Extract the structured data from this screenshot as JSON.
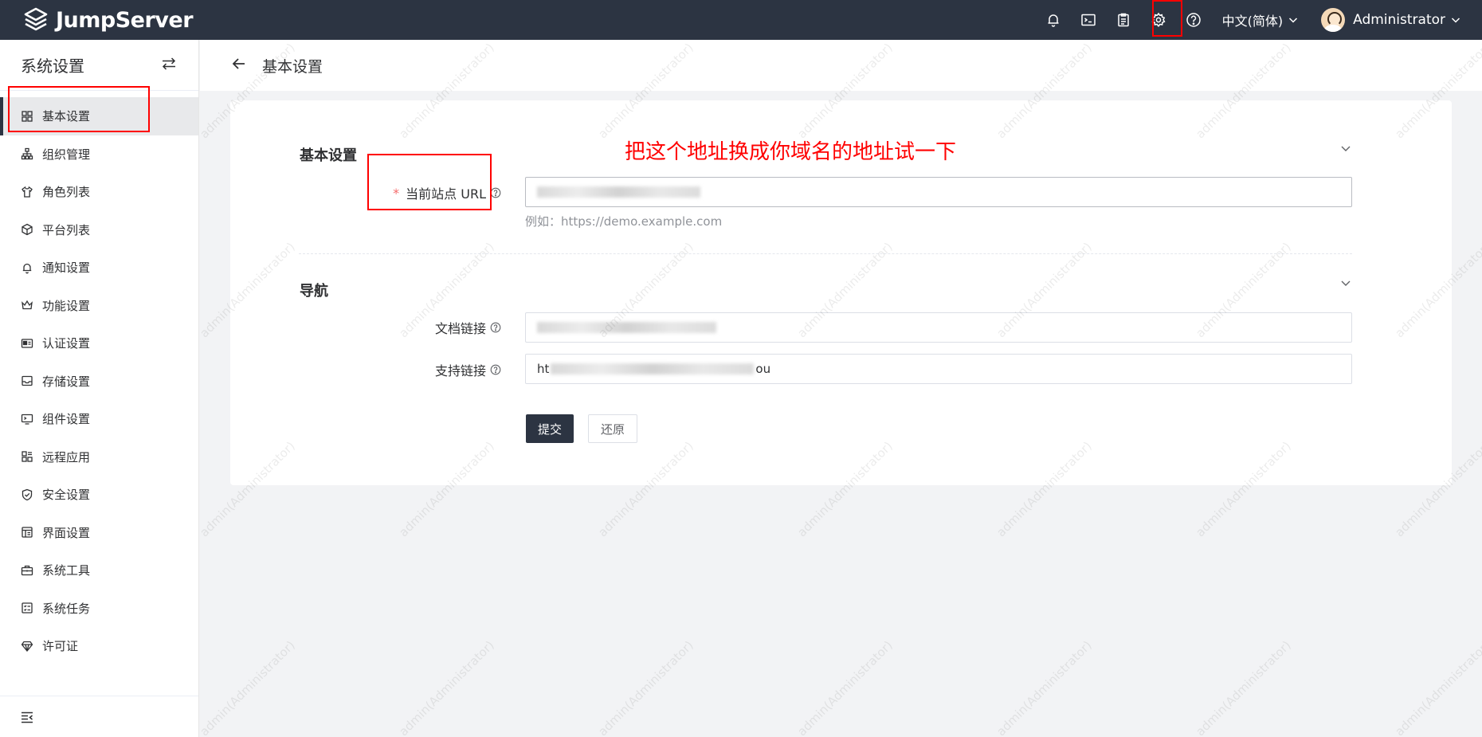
{
  "app": {
    "logo_text": "JumpServer"
  },
  "header": {
    "icons": [
      "bell-icon",
      "terminal-icon",
      "clipboard-icon",
      "gear-icon",
      "help-icon"
    ],
    "language": "中文(简体)",
    "user": "Administrator"
  },
  "sidebar": {
    "title": "系统设置",
    "items": [
      {
        "label": "基本设置",
        "icon": "grid-icon",
        "active": true
      },
      {
        "label": "组织管理",
        "icon": "org-icon"
      },
      {
        "label": "角色列表",
        "icon": "shirt-icon"
      },
      {
        "label": "平台列表",
        "icon": "cube-icon"
      },
      {
        "label": "通知设置",
        "icon": "bell-icon"
      },
      {
        "label": "功能设置",
        "icon": "crown-icon"
      },
      {
        "label": "认证设置",
        "icon": "idcard-icon"
      },
      {
        "label": "存储设置",
        "icon": "inbox-icon"
      },
      {
        "label": "组件设置",
        "icon": "monitor-icon"
      },
      {
        "label": "远程应用",
        "icon": "apps-icon"
      },
      {
        "label": "安全设置",
        "icon": "shield-icon"
      },
      {
        "label": "界面设置",
        "icon": "layout-icon"
      },
      {
        "label": "系统工具",
        "icon": "toolbox-icon"
      },
      {
        "label": "系统任务",
        "icon": "tasks-icon"
      },
      {
        "label": "许可证",
        "icon": "diamond-icon"
      }
    ]
  },
  "page": {
    "title": "基本设置"
  },
  "form": {
    "section1": {
      "title": "基本设置",
      "site_url_label": "当前站点 URL",
      "site_url_value": "",
      "site_url_hint": "例如：https://demo.example.com"
    },
    "section2": {
      "title": "导航",
      "doc_link_label": "文档链接",
      "support_link_label": "支持链接",
      "support_link_prefix": "ht",
      "support_link_suffix": "ou"
    },
    "submit_label": "提交",
    "reset_label": "还原"
  },
  "annotation": {
    "text": "把这个地址换成你域名的地址试一下",
    "color": "#ff0000"
  },
  "watermark": {
    "text": "admin(Administrator)"
  }
}
